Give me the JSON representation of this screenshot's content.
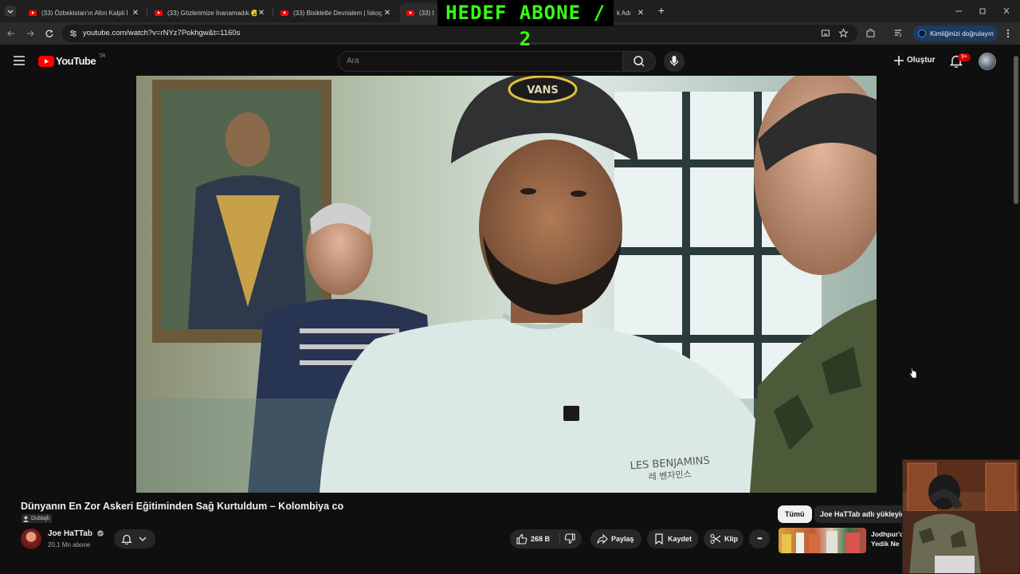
{
  "browser": {
    "tabs": [
      {
        "title": "(33) Özbekistan'ın Altın Kalpli İ"
      },
      {
        "title": "(33) Gözlerimize İnanamadık 😮"
      },
      {
        "title": "(33) Bisikletle Devrialem | İskoç"
      },
      {
        "title": "(33) Dü"
      },
      {
        "title": "k Adı"
      }
    ],
    "new_tab_label": "+",
    "url": "youtube.com/watch?v=rNYz7Pokhgw&t=1160s",
    "verify_label": "Kimliğinizi doğrulayın"
  },
  "overlay": {
    "banner_text": "HEDEF ABONE / 2"
  },
  "youtube": {
    "logo_text": "YouTube",
    "country_code": "TR",
    "search_placeholder": "Ara",
    "create_label": "Oluştur",
    "notifications_count": "9+"
  },
  "video": {
    "title": "Dünyanın En Zor Askeri Eğitiminden Sağ Kurtuldum – Kolombiya co",
    "dub_label": "Dublajlı",
    "shirt_text_line1": "LES BENJAMINS",
    "shirt_text_line2": "레 벤자민스",
    "cap_text": "VANS"
  },
  "channel": {
    "name": "Joe HaTTab",
    "subscribers": "20,1 Mn abone"
  },
  "actions": {
    "likes": "268 B",
    "share_label": "Paylaş",
    "save_label": "Kaydet",
    "clip_label": "Klip",
    "more_label": "•••"
  },
  "recommendations": {
    "chips": [
      "Tümü",
      "Joe HaTTab adlı yükleyic"
    ],
    "first_title_line1": "Jodhpur'c",
    "first_title_line2": "Yedik Ne"
  },
  "colors": {
    "background": "#0f0f0f",
    "youtube_red": "#ff0000",
    "banner_text_green": "#39ff14",
    "notification_badge": "#cc0000",
    "verify_button": "#1e3a5f"
  }
}
